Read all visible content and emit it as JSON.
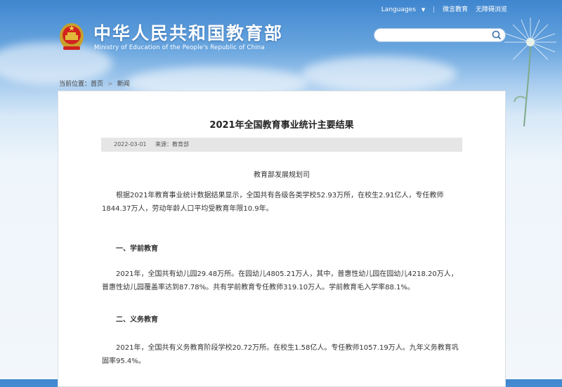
{
  "header": {
    "languages_label": "Languages",
    "weibo_label": "微言教育",
    "accessible_label": "无障碍浏览",
    "site_title": "中华人民共和国教育部",
    "site_subtitle": "Ministry of Education of the People's Republic of China",
    "search": {
      "placeholder": ""
    }
  },
  "breadcrumb": {
    "prefix": "当前位置：",
    "home": "首页",
    "separator": ">",
    "current": "新闻"
  },
  "article": {
    "title": "2021年全国教育事业统计主要结果",
    "date": "2022-03-01",
    "source": "来源：教育部",
    "department": "教育部发展规划司",
    "intro": "根据2021年教育事业统计数据结果显示，全国共有各级各类学校52.93万所，在校生2.91亿人，专任教师1844.37万人，劳动年龄人口平均受教育年限10.9年。",
    "section1_heading": "一、学前教育",
    "section1_text": "2021年，全国共有幼儿园29.48万所。在园幼儿4805.21万人，其中，普惠性幼儿园在园幼儿4218.20万人，普惠性幼儿园覆盖率达到87.78%。共有学前教育专任教师319.10万人。学前教育毛入学率88.1%。",
    "section2_heading": "二、义务教育",
    "section2_text": "2021年，全国共有义务教育阶段学校20.72万所。在校生1.58亿人。专任教师1057.19万人。九年义务教育巩固率95.4%。"
  }
}
